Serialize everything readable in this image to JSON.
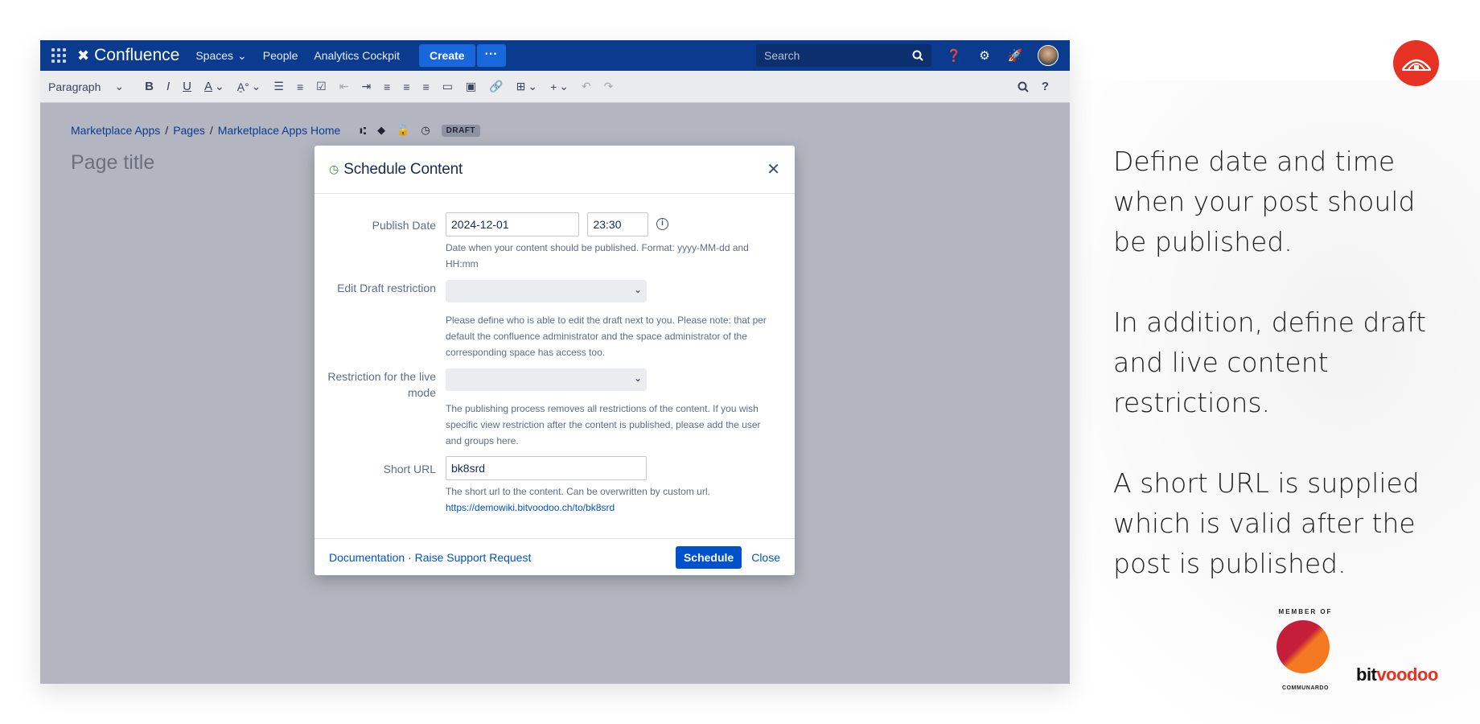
{
  "topnav": {
    "brand": "Confluence",
    "spaces": "Spaces",
    "people": "People",
    "analytics": "Analytics Cockpit",
    "create": "Create",
    "more": "···",
    "search_placeholder": "Search"
  },
  "toolbar": {
    "paragraph": "Paragraph"
  },
  "editor": {
    "breadcrumb": [
      "Marketplace Apps",
      "Pages",
      "Marketplace Apps Home"
    ],
    "breadcrumb_sep": "/",
    "draft_badge": "DRAFT",
    "page_title_placeholder": "Page title"
  },
  "modal": {
    "title": "Schedule Content",
    "close_x": "✕",
    "publish_date": {
      "label": "Publish Date",
      "date_value": "2024-12-01",
      "time_value": "23:30",
      "help": "Date when your content should be published. Format: yyyy-MM-dd and HH:mm"
    },
    "edit_draft": {
      "label": "Edit Draft restriction",
      "help": "Please define who is able to edit the draft next to you. Please note: that per default the confluence administrator and the space administrator of the corresponding space has access too."
    },
    "live_mode": {
      "label": "Restriction for the live mode",
      "help": "The publishing process removes all restrictions of the content. If you wish specific view restriction after the content is published, please add the user and groups here."
    },
    "short_url": {
      "label": "Short URL",
      "value": "bk8srd",
      "help": "The short url to the content. Can be overwritten by custom url.",
      "link": "https://demowiki.bitvoodoo.ch/to/bk8srd"
    },
    "footer": {
      "links": "Documentation · Raise Support Request",
      "schedule": "Schedule",
      "close": "Close"
    }
  },
  "side_text": [
    "Define date and time when your post should be published.",
    "In addition, define draft and live content restrictions.",
    "A short URL is supplied which is valid after the post is published."
  ],
  "badges": {
    "member_of": "MEMBER OF",
    "communardo": "COMMUNARDO",
    "bitvoodoo_bit": "bit",
    "bitvoodoo_voodoo": "voodoo"
  },
  "colors": {
    "nav_bg": "#0a3b8f",
    "primary": "#0052cc",
    "brand_red": "#e53222"
  }
}
